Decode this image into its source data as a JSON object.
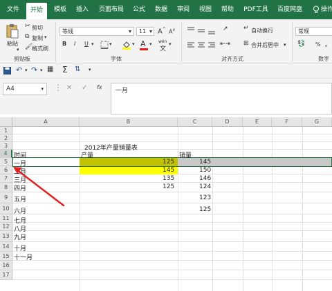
{
  "ribbon_tabs": [
    {
      "label": "文件"
    },
    {
      "label": "开始"
    },
    {
      "label": "模板"
    },
    {
      "label": "插入"
    },
    {
      "label": "页面布局"
    },
    {
      "label": "公式"
    },
    {
      "label": "数据"
    },
    {
      "label": "审阅"
    },
    {
      "label": "视图"
    },
    {
      "label": "帮助"
    },
    {
      "label": "PDF工具"
    },
    {
      "label": "百度网盘"
    },
    {
      "label": "操作"
    }
  ],
  "clipboard": {
    "paste": "粘贴",
    "cut": "剪切",
    "copy": "复制",
    "format_painter": "格式刷",
    "group": "剪贴板"
  },
  "font": {
    "name": "等线",
    "size": "11",
    "bold": "B",
    "italic": "I",
    "underline": "U",
    "group": "字体",
    "grow": "A",
    "shrink": "A",
    "color_letter": "A",
    "fill_color": "#ffff00",
    "font_color": "#e02020",
    "wen": "wén"
  },
  "alignment": {
    "wrap": "自动换行",
    "merge": "合并后居中",
    "group": "对齐方式"
  },
  "number": {
    "format": "常规",
    "percent": "%",
    "group": "数字"
  },
  "formula_bar": {
    "name_box": "A4",
    "fx": "fx",
    "content": "一月"
  },
  "columns": [
    "A",
    "B",
    "C",
    "D",
    "E",
    "F",
    "G"
  ],
  "rows": [
    "1",
    "2",
    "3",
    "4",
    "5",
    "6",
    "7",
    "8",
    "9",
    "10",
    "11",
    "12",
    "13",
    "14",
    "15",
    "16",
    "17"
  ],
  "sheet": {
    "title": "2012年产量销量表",
    "header_time": "时间",
    "header_production": "产量",
    "header_sales": "销量",
    "months": [
      "一月",
      "二月",
      "三月",
      "四月",
      "五月",
      "六月",
      "七月",
      "八月",
      "九月",
      "十月",
      "十一月"
    ],
    "production": [
      "125",
      "145",
      "135",
      "125"
    ],
    "sales": [
      "145",
      "150",
      "146",
      "124",
      "123",
      "125"
    ],
    "highlight_color": "#ffff00",
    "arrow_color": "#e02020"
  }
}
